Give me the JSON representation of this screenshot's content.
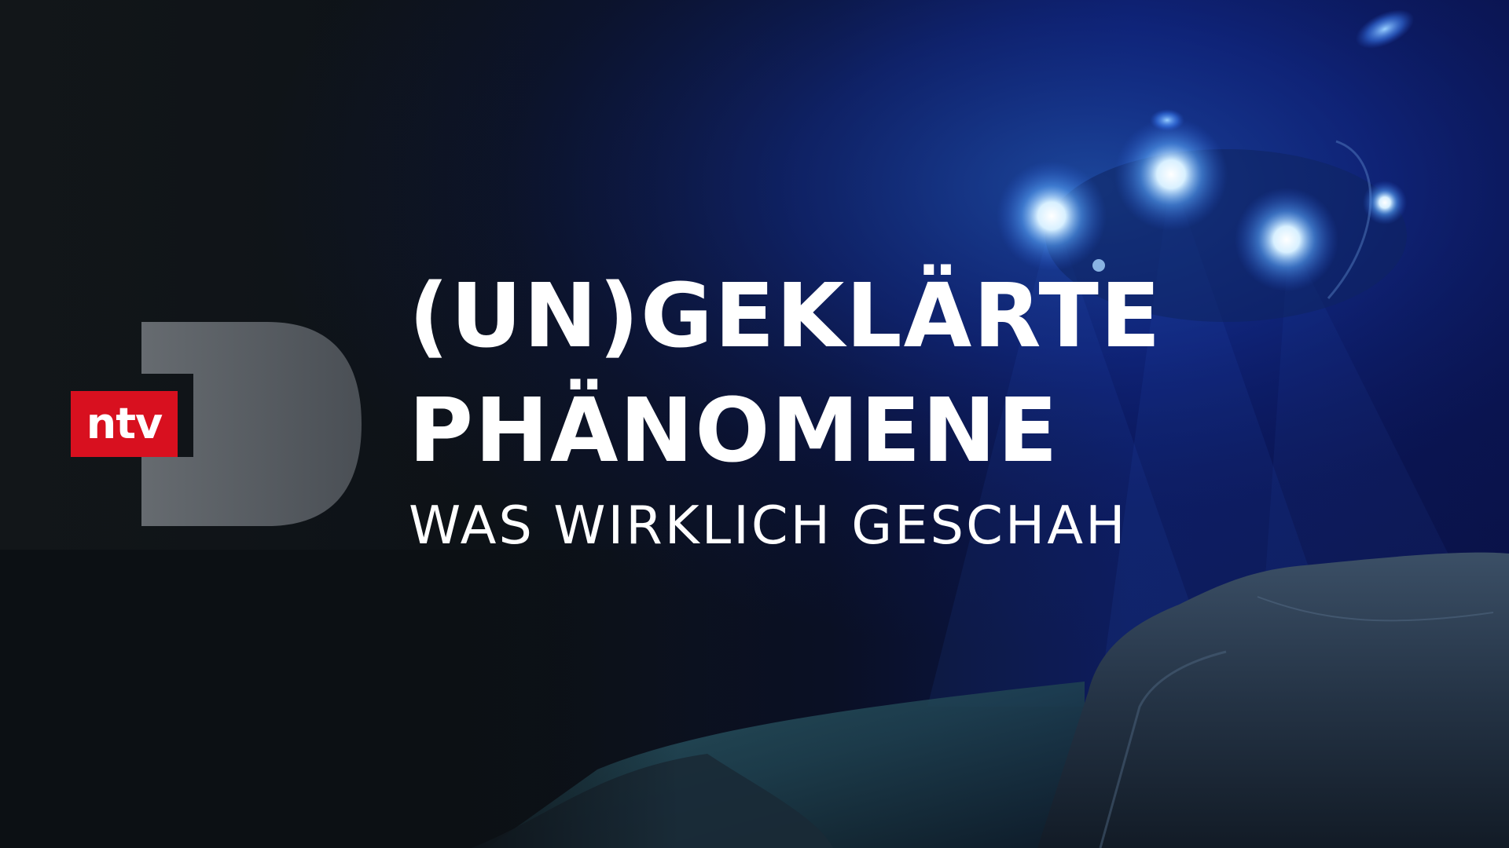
{
  "title": {
    "line1": "(UN)GEKLÄRTE",
    "line2": "PHÄNOMENE",
    "subtitle": "WAS WIRKLICH GESCHAH"
  },
  "logo": {
    "text": "ntv",
    "brand_color": "#d8101f",
    "d_shape_color": "#5b6066",
    "icon": "ntv-logo"
  },
  "colors": {
    "background_dark": "#0a0e13",
    "deep_blue": "#0b1a6e",
    "light_glow": "#bfe4ff",
    "text": "#ffffff"
  }
}
